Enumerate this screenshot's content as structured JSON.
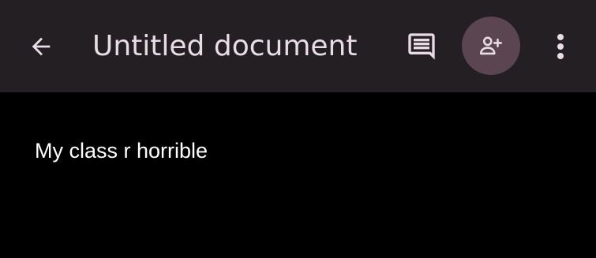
{
  "header": {
    "title": "Untitled document",
    "back_icon": "arrow-back-icon",
    "comments_icon": "comment-icon",
    "share_icon": "person-add-icon",
    "more_icon": "more-vert-icon"
  },
  "document": {
    "content": "My class r horrible"
  },
  "colors": {
    "header_background": "#231f23",
    "page_background": "#000000",
    "share_button_background": "#5a4551",
    "icon_color": "#e8dde5",
    "text_color": "#ffffff"
  }
}
